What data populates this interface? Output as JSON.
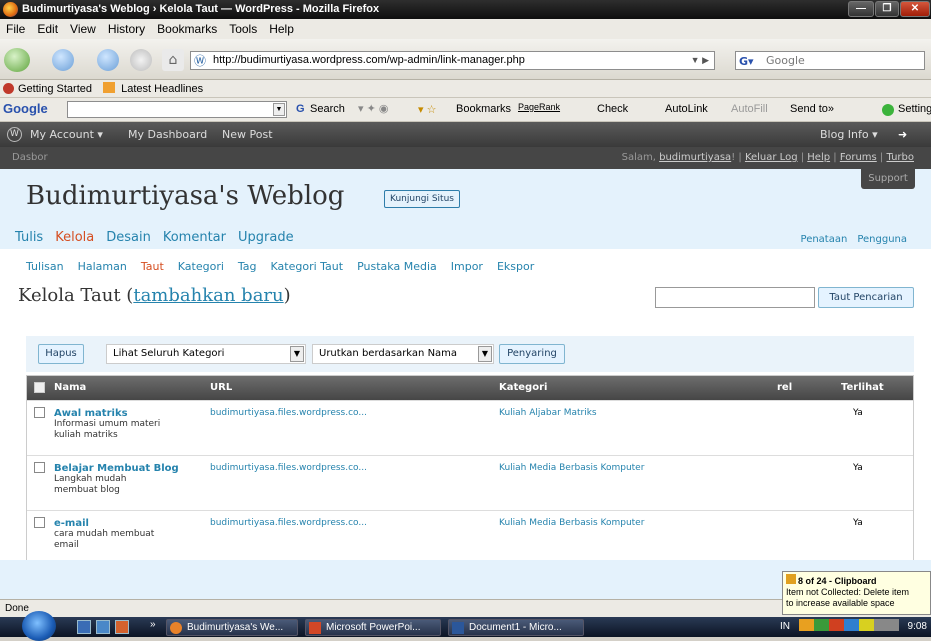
{
  "window": {
    "title": "Budimurtiyasa's Weblog › Kelola Taut — WordPress - Mozilla Firefox"
  },
  "menu": [
    "File",
    "Edit",
    "View",
    "History",
    "Bookmarks",
    "Tools",
    "Help"
  ],
  "nav": {
    "url": "http://budimurtiyasa.wordpress.com/wp-admin/link-manager.php",
    "search_placeholder": "Google"
  },
  "bookmarks": [
    "Getting Started",
    "Latest Headlines"
  ],
  "gtoolbar": {
    "logo": "Google",
    "items": [
      "Search",
      "Bookmarks",
      "PageRank",
      "Check",
      "AutoLink",
      "AutoFill",
      "Send to»",
      "Settings"
    ]
  },
  "wpbar": {
    "left": [
      "My Account",
      "My Dashboard",
      "New Post"
    ],
    "right": "Blog Info"
  },
  "dasbor": {
    "label": "Dasbor",
    "greeting": "Salam,",
    "user": "budimurtiyasa",
    "greeting_end": "!",
    "logout": "Keluar Log",
    "help": "Help",
    "forums": "Forums",
    "turbo": "Turbo",
    "support": "Support"
  },
  "blog": {
    "title": "Budimurtiyasa's Weblog",
    "visit": "Kunjungi Situs"
  },
  "maintabs": [
    "Tulis",
    "Kelola",
    "Desain",
    "Komentar",
    "Upgrade"
  ],
  "righttabs": [
    "Penataan",
    "Pengguna"
  ],
  "subtabs": [
    "Tulisan",
    "Halaman",
    "Taut",
    "Kategori",
    "Tag",
    "Kategori Taut",
    "Pustaka Media",
    "Impor",
    "Ekspor"
  ],
  "page": {
    "title_prefix": "Kelola Taut (",
    "title_link": "tambahkan baru",
    "title_suffix": ")",
    "search_button": "Taut Pencarian"
  },
  "filter": {
    "delete": "Hapus",
    "category": "Lihat Seluruh Kategori",
    "sort": "Urutkan berdasarkan Nama",
    "filter_btn": "Penyaring"
  },
  "table": {
    "headers": {
      "name": "Nama",
      "url": "URL",
      "category": "Kategori",
      "rel": "rel",
      "visible": "Terlihat"
    },
    "rows": [
      {
        "name": "Awal matriks",
        "desc": "Informasi umum materi kuliah matriks",
        "url": "budimurtiyasa.files.wordpress.co...",
        "category": "Kuliah Aljabar Matriks",
        "rel": "",
        "visible": "Ya"
      },
      {
        "name": "Belajar Membuat Blog",
        "desc": "Langkah mudah membuat blog",
        "url": "budimurtiyasa.files.wordpress.co...",
        "category": "Kuliah Media Berbasis Komputer",
        "rel": "",
        "visible": "Ya"
      },
      {
        "name": "e-mail",
        "desc": "cara mudah membuat email",
        "url": "budimurtiyasa.files.wordpress.co...",
        "category": "Kuliah Media Berbasis Komputer",
        "rel": "",
        "visible": "Ya"
      }
    ]
  },
  "status": "Done",
  "clipboard": {
    "title": "8 of 24 - Clipboard",
    "line1": "Item not Collected: Delete item",
    "line2": "to increase available space"
  },
  "taskbar": {
    "tasks": [
      "Budimurtiyasa's We...",
      "Microsoft PowerPoi...",
      "Document1 - Micro..."
    ],
    "lang": "IN",
    "time": "9:08"
  }
}
